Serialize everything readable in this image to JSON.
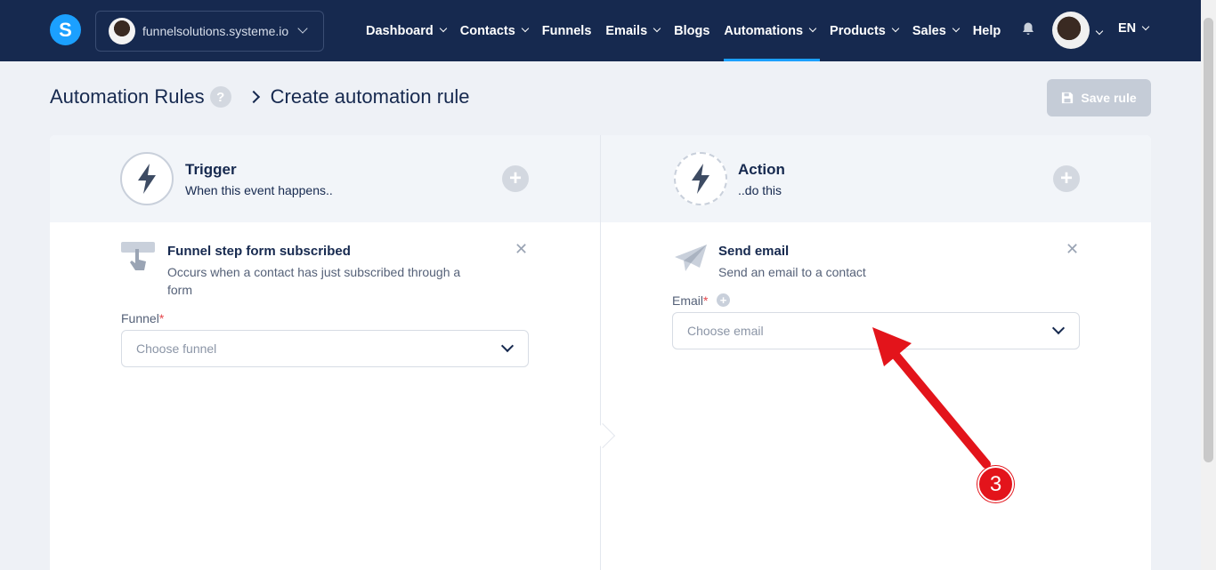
{
  "topbar": {
    "logo_letter": "S",
    "site_name": "funnelsolutions.systeme.io",
    "nav": [
      {
        "label": "Dashboard",
        "has_dropdown": true,
        "active": false
      },
      {
        "label": "Contacts",
        "has_dropdown": true,
        "active": false
      },
      {
        "label": "Funnels",
        "has_dropdown": false,
        "active": false
      },
      {
        "label": "Emails",
        "has_dropdown": true,
        "active": false
      },
      {
        "label": "Blogs",
        "has_dropdown": false,
        "active": false
      },
      {
        "label": "Automations",
        "has_dropdown": true,
        "active": true
      },
      {
        "label": "Products",
        "has_dropdown": true,
        "active": false
      },
      {
        "label": "Sales",
        "has_dropdown": true,
        "active": false
      },
      {
        "label": "Help",
        "has_dropdown": false,
        "active": false
      }
    ],
    "language": "EN"
  },
  "header": {
    "breadcrumb_parent": "Automation Rules",
    "help_icon": "?",
    "breadcrumb_current": "Create automation rule",
    "save_label": "Save rule"
  },
  "trigger": {
    "title": "Trigger",
    "subtitle": "When this event happens..",
    "item_title": "Funnel step form subscribed",
    "item_desc": "Occurs when a contact has just subscribed through a form",
    "field_label": "Funnel",
    "field_placeholder": "Choose funnel"
  },
  "action": {
    "title": "Action",
    "subtitle": "..do this",
    "item_title": "Send email",
    "item_desc": "Send an email to a contact",
    "field_label": "Email",
    "field_placeholder": "Choose email"
  },
  "annotation": {
    "step_number": "3",
    "color": "#e3141b"
  },
  "colors": {
    "nav_bg": "#16294f",
    "accent": "#1ba0ff",
    "page_bg": "#eef1f6"
  }
}
